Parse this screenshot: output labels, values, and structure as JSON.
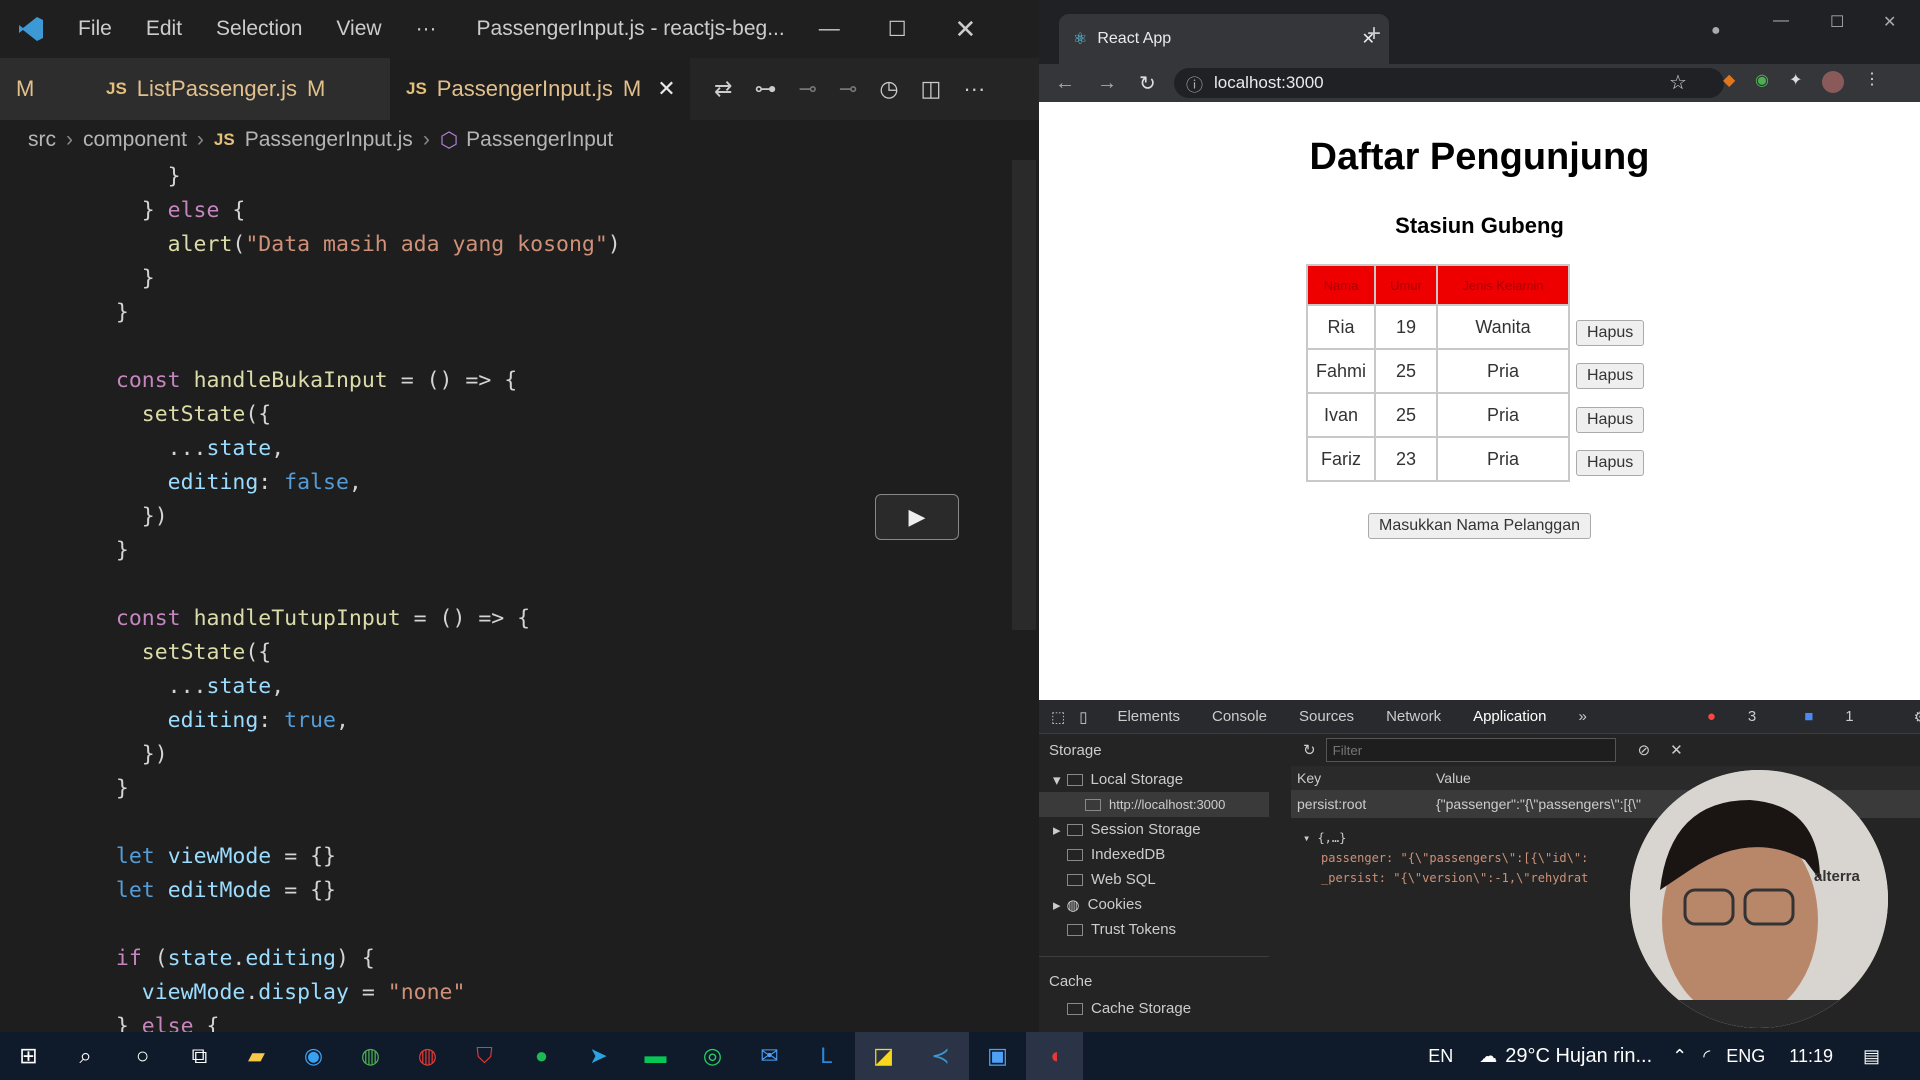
{
  "vscode": {
    "menu": [
      "File",
      "Edit",
      "Selection",
      "View",
      "···"
    ],
    "title": "PassengerInput.js - reactjs-beg...",
    "tabs": [
      {
        "label": "M",
        "partial": true
      },
      {
        "label": "ListPassenger.js",
        "mod": "M"
      },
      {
        "label": "PassengerInput.js",
        "mod": "M"
      }
    ],
    "breadcrumb": [
      "src",
      "component",
      "PassengerInput.js",
      "PassengerInput"
    ],
    "code": [
      "      }",
      "    } else {",
      "      alert(\"Data masih ada yang kosong\")",
      "    }",
      "  }",
      "",
      "  const handleBukaInput = () => {",
      "    setState({",
      "      ...state,",
      "      editing: false,",
      "    })",
      "  }",
      "",
      "  const handleTutupInput = () => {",
      "    setState({",
      "      ...state,",
      "      editing: true,",
      "    })",
      "  }",
      "",
      "  let viewMode = {}",
      "  let editMode = {}",
      "",
      "  if (state.editing) {",
      "    viewMode.display = \"none\"",
      "  } else {"
    ]
  },
  "browser": {
    "tab_title": "React App",
    "url": "localhost:3000",
    "page": {
      "title": "Daftar Pengunjung",
      "subtitle": "Stasiun Gubeng",
      "headers": [
        "Nama",
        "Umur",
        "Jenis Kelamin"
      ],
      "rows": [
        [
          "Ria",
          "19",
          "Wanita"
        ],
        [
          "Fahmi",
          "25",
          "Pria"
        ],
        [
          "Ivan",
          "25",
          "Pria"
        ],
        [
          "Fariz",
          "23",
          "Pria"
        ]
      ],
      "delete_label": "Hapus",
      "add_button": "Masukkan Nama Pelanggan"
    }
  },
  "devtools": {
    "tabs": [
      "Elements",
      "Console",
      "Sources",
      "Network",
      "Application",
      "»"
    ],
    "errors": "3",
    "messages": "1",
    "storage_heading": "Storage",
    "tree": [
      "Local Storage",
      "http://localhost:3000",
      "Session Storage",
      "IndexedDB",
      "Web SQL",
      "Cookies",
      "Trust Tokens"
    ],
    "cache_heading": "Cache",
    "cache_item": "Cache Storage",
    "filter_placeholder": "Filter",
    "col_key": "Key",
    "col_value": "Value",
    "row_key": "persist:root",
    "row_value": "{\"passenger\":\"{\\\"passengers\\\":[{\\\"",
    "preview_head": "▾ {,…}",
    "preview_1": "passenger: \"{\\\"passengers\\\":[{\\\"id\\\":",
    "preview_2": "_persist: \"{\\\"version\\\":-1,\\\"rehydrat",
    "watermark": "alterra"
  },
  "taskbar": {
    "lang": "EN",
    "weather": "29°C  Hujan rin...",
    "ime": "ENG",
    "time": "11:19"
  }
}
